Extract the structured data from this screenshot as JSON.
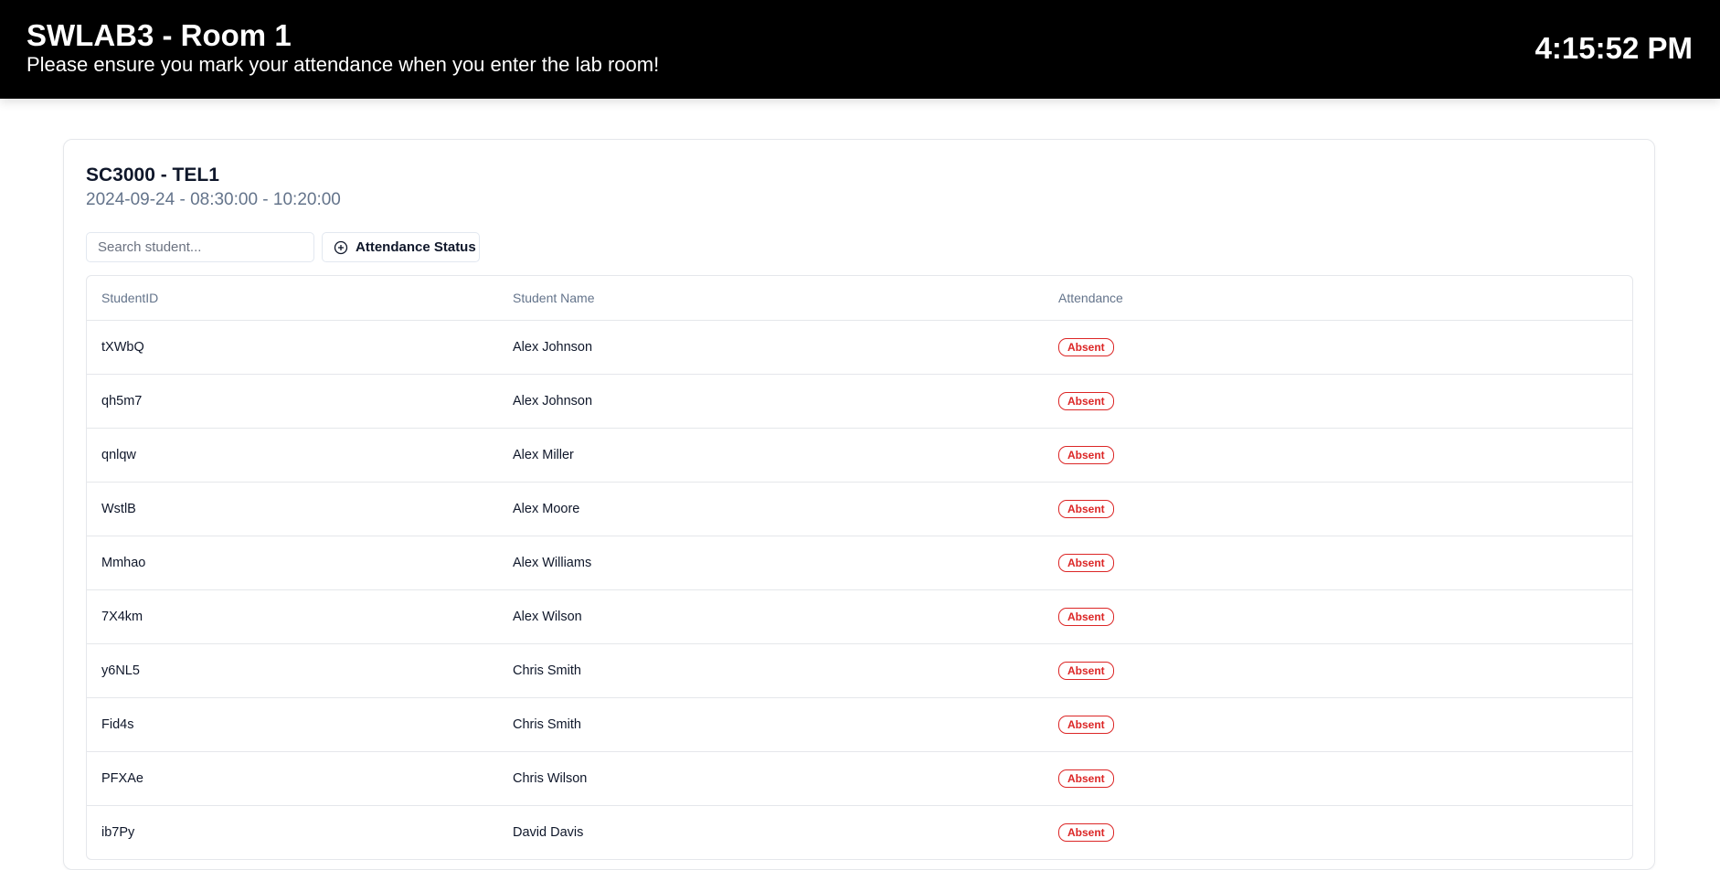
{
  "header": {
    "room_title": "SWLAB3 - Room 1",
    "notice": "Please ensure you mark your attendance when you enter the lab room!",
    "clock": "4:15:52 PM"
  },
  "session": {
    "course": "SC3000 - TEL1",
    "datetime": "2024-09-24 - 08:30:00 - 10:20:00"
  },
  "search": {
    "placeholder": "Search student...",
    "value": ""
  },
  "filter": {
    "label": "Attendance Status",
    "icon": "plus-circle-icon"
  },
  "table": {
    "columns": [
      "StudentID",
      "Student Name",
      "Attendance"
    ],
    "rows": [
      {
        "id": "tXWbQ",
        "name": "Alex Johnson",
        "status": "Absent"
      },
      {
        "id": "qh5m7",
        "name": "Alex Johnson",
        "status": "Absent"
      },
      {
        "id": "qnlqw",
        "name": "Alex Miller",
        "status": "Absent"
      },
      {
        "id": "WstlB",
        "name": "Alex Moore",
        "status": "Absent"
      },
      {
        "id": "Mmhao",
        "name": "Alex Williams",
        "status": "Absent"
      },
      {
        "id": "7X4km",
        "name": "Alex Wilson",
        "status": "Absent"
      },
      {
        "id": "y6NL5",
        "name": "Chris Smith",
        "status": "Absent"
      },
      {
        "id": "Fid4s",
        "name": "Chris Smith",
        "status": "Absent"
      },
      {
        "id": "PFXAe",
        "name": "Chris Wilson",
        "status": "Absent"
      },
      {
        "id": "ib7Py",
        "name": "David Davis",
        "status": "Absent"
      }
    ]
  },
  "colors": {
    "header_bg": "#000000",
    "absent": "#dc2626",
    "muted": "#64748b"
  }
}
